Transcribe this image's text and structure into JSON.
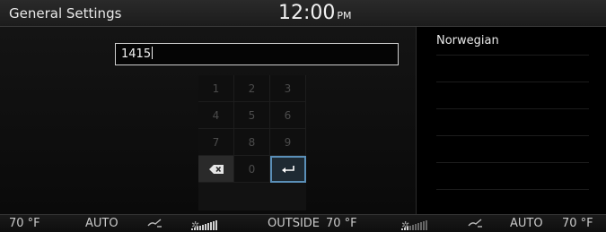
{
  "header": {
    "title": "General Settings",
    "clock": "12:00",
    "ampm": "PM"
  },
  "entry": {
    "value": "1415"
  },
  "keypad": {
    "keys": [
      "1",
      "2",
      "3",
      "4",
      "5",
      "6",
      "7",
      "8",
      "9",
      "0"
    ],
    "delete_icon": "backspace-icon",
    "enter_icon": "enter-icon"
  },
  "side_panel": {
    "language": "Norwegian"
  },
  "climate": {
    "left_temp": "70 °F",
    "left_mode": "AUTO",
    "outside_label": "OUTSIDE",
    "outside_temp": "70 °F",
    "right_mode": "AUTO",
    "right_temp": "70 °F",
    "left_fan_level": 1.0,
    "right_fan_level": 0.3,
    "accent_color": "#5a8fb8"
  }
}
